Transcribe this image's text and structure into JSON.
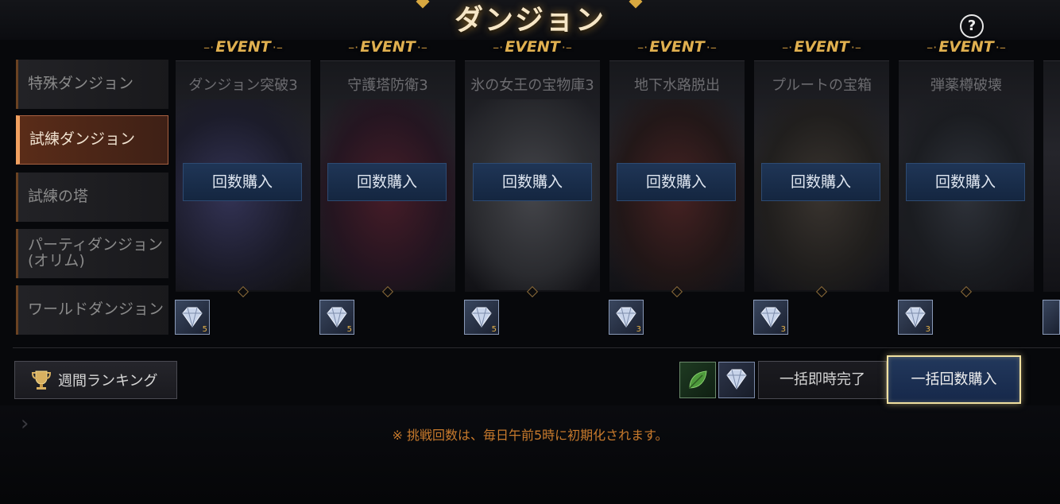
{
  "header": {
    "title": "ダンジョン",
    "help_icon": "?"
  },
  "sidebar": {
    "items": [
      {
        "label": "特殊ダンジョン",
        "active": false
      },
      {
        "label": "試練ダンジョン",
        "active": true
      },
      {
        "label": "試練の塔",
        "active": false
      },
      {
        "label": "パーティダンジョン\n(オリム)",
        "active": false
      },
      {
        "label": "ワールドダンジョン",
        "active": false
      }
    ]
  },
  "event_label": "EVENT",
  "dungeons": [
    {
      "name": "ダンジョン突破3",
      "button": "回数購入",
      "item_count": "5"
    },
    {
      "name": "守護塔防衛3",
      "button": "回数購入",
      "item_count": "5"
    },
    {
      "name": "氷の女王の宝物庫3",
      "button": "回数購入",
      "item_count": "5"
    },
    {
      "name": "地下水路脱出",
      "button": "回数購入",
      "item_count": "3"
    },
    {
      "name": "プルートの宝箱",
      "button": "回数購入",
      "item_count": "3"
    },
    {
      "name": "弾薬樽破壊",
      "button": "回数購入",
      "item_count": "3"
    }
  ],
  "footer": {
    "ranking_label": "週間ランキング",
    "instant_complete_label": "一括即時完了",
    "bulk_purchase_label": "一括回数購入",
    "notice": "※  挑戦回数は、毎日午前5時に初期化されます。"
  },
  "colors": {
    "accent_gold": "#e0b050",
    "active_tab": "#5a2c18",
    "button_blue": "#1f3556",
    "notice_orange": "#c87a2c"
  }
}
